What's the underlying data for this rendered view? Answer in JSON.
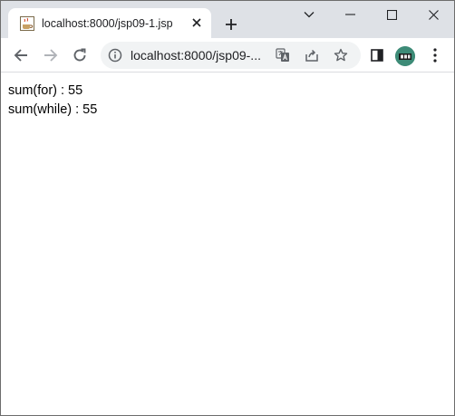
{
  "tab": {
    "title": "localhost:8000/jsp09-1.jsp",
    "favicon_icon": "java-coffee-icon",
    "close_icon": "close-icon"
  },
  "tabstrip": {
    "new_tab_icon": "plus-icon",
    "window_controls": [
      "chevron-down-icon",
      "minimize-icon",
      "maximize-icon",
      "close-icon"
    ]
  },
  "toolbar": {
    "back_icon": "back-arrow-icon",
    "forward_icon": "forward-arrow-icon",
    "reload_icon": "reload-icon",
    "url": "localhost:8000/jsp09-...",
    "site_info_icon": "info-icon",
    "omnibox_actions": [
      "translate-icon",
      "share-icon",
      "star-icon"
    ],
    "side_panel_icon": "side-panel-icon",
    "profile_icon": "avatar",
    "menu_icon": "kebab-menu-icon"
  },
  "content": {
    "lines": [
      "sum(for) : 55",
      "sum(while) : 55"
    ]
  },
  "colors": {
    "tabstrip_bg": "#dee1e6",
    "omnibox_bg": "#f1f3f4",
    "avatar_bg": "#3d8b77"
  }
}
